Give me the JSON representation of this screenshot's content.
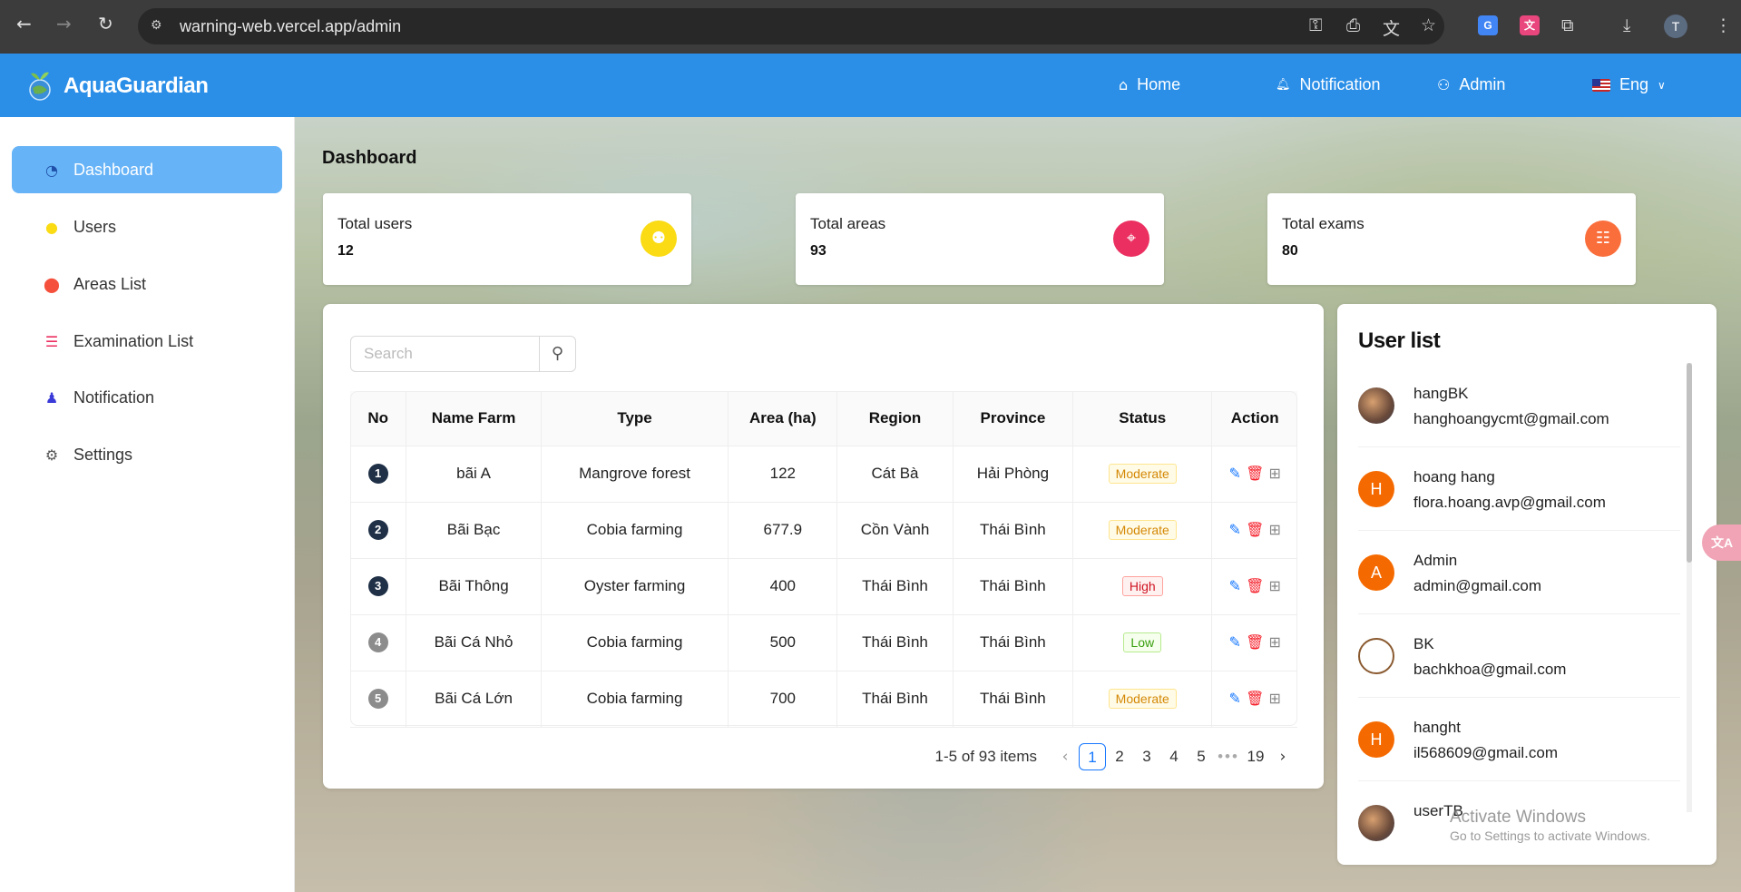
{
  "browser": {
    "url": "warning-web.vercel.app/admin",
    "profile_initial": "T"
  },
  "header": {
    "brand": "AquaGuardian",
    "nav": {
      "home": "Home",
      "notification": "Notification",
      "admin": "Admin",
      "language": "Eng"
    }
  },
  "sidebar": {
    "items": [
      {
        "label": "Dashboard",
        "icon": "dashboard-icon",
        "active": true
      },
      {
        "label": "Users",
        "icon": "user-icon"
      },
      {
        "label": "Areas List",
        "icon": "map-pin-icon"
      },
      {
        "label": "Examination List",
        "icon": "list-icon"
      },
      {
        "label": "Notification",
        "icon": "bell-icon"
      },
      {
        "label": "Settings",
        "icon": "gear-icon"
      }
    ]
  },
  "page": {
    "title": "Dashboard"
  },
  "stats": [
    {
      "label": "Total users",
      "value": "12",
      "icon": "users-icon",
      "color": "#fadb14"
    },
    {
      "label": "Total areas",
      "value": "93",
      "icon": "map-icon",
      "color": "#eb2f60"
    },
    {
      "label": "Total exams",
      "value": "80",
      "icon": "clipboard-icon",
      "color": "#fa6e3c"
    }
  ],
  "table": {
    "search_placeholder": "Search",
    "columns": [
      "No",
      "Name Farm",
      "Type",
      "Area (ha)",
      "Region",
      "Province",
      "Status",
      "Action"
    ],
    "rows": [
      {
        "no": "1",
        "name": "bãi A",
        "type": "Mangrove forest",
        "area": "122",
        "region": "Cát Bà",
        "province": "Hải Phòng",
        "status": "Moderate"
      },
      {
        "no": "2",
        "name": "Bãi Bạc",
        "type": "Cobia farming",
        "area": "677.9",
        "region": "Cồn Vành",
        "province": "Thái Bình",
        "status": "Moderate"
      },
      {
        "no": "3",
        "name": "Bãi Thông",
        "type": "Oyster farming",
        "area": "400",
        "region": "Thái Bình",
        "province": "Thái Bình",
        "status": "High"
      },
      {
        "no": "4",
        "name": "Bãi Cá Nhỏ",
        "type": "Cobia farming",
        "area": "500",
        "region": "Thái Bình",
        "province": "Thái Bình",
        "status": "Low"
      },
      {
        "no": "5",
        "name": "Bãi Cá Lớn",
        "type": "Cobia farming",
        "area": "700",
        "region": "Thái Bình",
        "province": "Thái Bình",
        "status": "Moderate"
      }
    ],
    "pagination": {
      "summary": "1-5 of 93 items",
      "pages": [
        "1",
        "2",
        "3",
        "4",
        "5"
      ],
      "ellipsis": "•••",
      "last": "19",
      "current": "1"
    }
  },
  "user_list": {
    "title": "User list",
    "users": [
      {
        "name": "hangBK",
        "email": "hanghoangycmt@gmail.com",
        "avatar": "photo",
        "initial": ""
      },
      {
        "name": "hoang hang",
        "email": "flora.hoang.avp@gmail.com",
        "avatar": "orange",
        "initial": "H"
      },
      {
        "name": "Admin",
        "email": "admin@gmail.com",
        "avatar": "orange",
        "initial": "A"
      },
      {
        "name": "BK",
        "email": "bachkhoa@gmail.com",
        "avatar": "doc",
        "initial": ""
      },
      {
        "name": "hanght",
        "email": "il568609@gmail.com",
        "avatar": "orange",
        "initial": "H"
      },
      {
        "name": "userTB",
        "email": "",
        "avatar": "photo",
        "initial": ""
      }
    ]
  },
  "overlay": {
    "activate_title": "Activate Windows",
    "activate_sub": "Go to Settings to activate Windows."
  }
}
